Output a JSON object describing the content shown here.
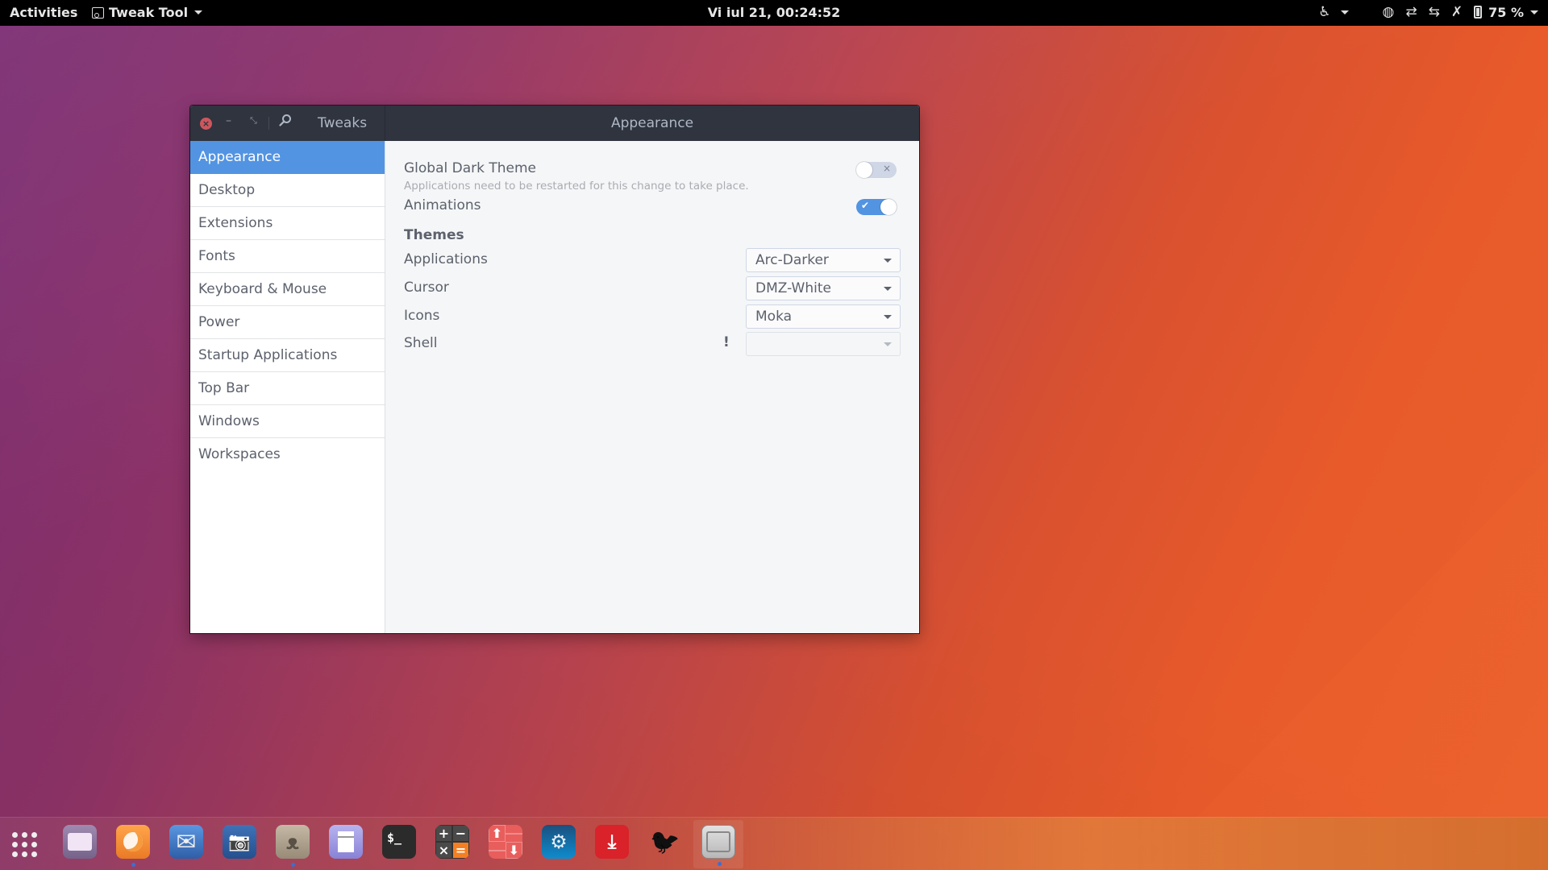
{
  "topbar": {
    "activities": "Activities",
    "app_menu": "Tweak Tool",
    "clock": "Vi iul 21, 00:24:52",
    "tray": {
      "accessibility_icon": "accessibility-icon",
      "network_icon": "network-vpn-icon",
      "transfer_icon": "network-transfer-icon",
      "network_secure_icon": "network-secure-icon",
      "mute_icon": "volume-muted-icon",
      "battery_icon": "battery-icon",
      "battery_label": "75 %"
    }
  },
  "window": {
    "app_title": "Tweaks",
    "page_title": "Appearance",
    "controls": {
      "close": "×",
      "minimize": "–",
      "maximize": "⤡",
      "search": "⚲"
    }
  },
  "sidebar": {
    "items": [
      {
        "label": "Appearance",
        "active": true
      },
      {
        "label": "Desktop"
      },
      {
        "label": "Extensions"
      },
      {
        "label": "Fonts"
      },
      {
        "label": "Keyboard & Mouse"
      },
      {
        "label": "Power"
      },
      {
        "label": "Startup Applications"
      },
      {
        "label": "Top Bar"
      },
      {
        "label": "Windows"
      },
      {
        "label": "Workspaces"
      }
    ]
  },
  "content": {
    "global_dark_theme": {
      "label": "Global Dark Theme",
      "sub": "Applications need to be restarted for this change to take place.",
      "enabled": false,
      "off_mark": "×"
    },
    "animations": {
      "label": "Animations",
      "enabled": true,
      "on_mark": "✔"
    },
    "themes_heading": "Themes",
    "themes": {
      "applications": {
        "label": "Applications",
        "value": "Arc-Darker"
      },
      "cursor": {
        "label": "Cursor",
        "value": "DMZ-White"
      },
      "icons": {
        "label": "Icons",
        "value": "Moka"
      },
      "shell": {
        "label": "Shell",
        "value": "",
        "warning": "!"
      }
    }
  },
  "dock": {
    "items": [
      {
        "name": "show-applications",
        "running": false
      },
      {
        "name": "files",
        "running": false
      },
      {
        "name": "firefox",
        "running": true
      },
      {
        "name": "mail",
        "running": false
      },
      {
        "name": "screenshot",
        "running": false
      },
      {
        "name": "gimp",
        "running": true
      },
      {
        "name": "text-editor",
        "running": false
      },
      {
        "name": "terminal",
        "running": false,
        "glyph": "$_"
      },
      {
        "name": "calculator",
        "running": false,
        "glyphs": [
          "+",
          "−",
          "×",
          "="
        ]
      },
      {
        "name": "transfer",
        "running": false,
        "glyphs": [
          "⬆",
          "",
          "",
          "⬇"
        ]
      },
      {
        "name": "steam",
        "running": false
      },
      {
        "name": "downloader",
        "running": false
      },
      {
        "name": "bird-app",
        "running": false
      },
      {
        "name": "tweak-tool",
        "running": true
      }
    ]
  },
  "colors": {
    "accent": "#5294e2",
    "header_bg": "#2f343f",
    "close": "#cc575d"
  }
}
